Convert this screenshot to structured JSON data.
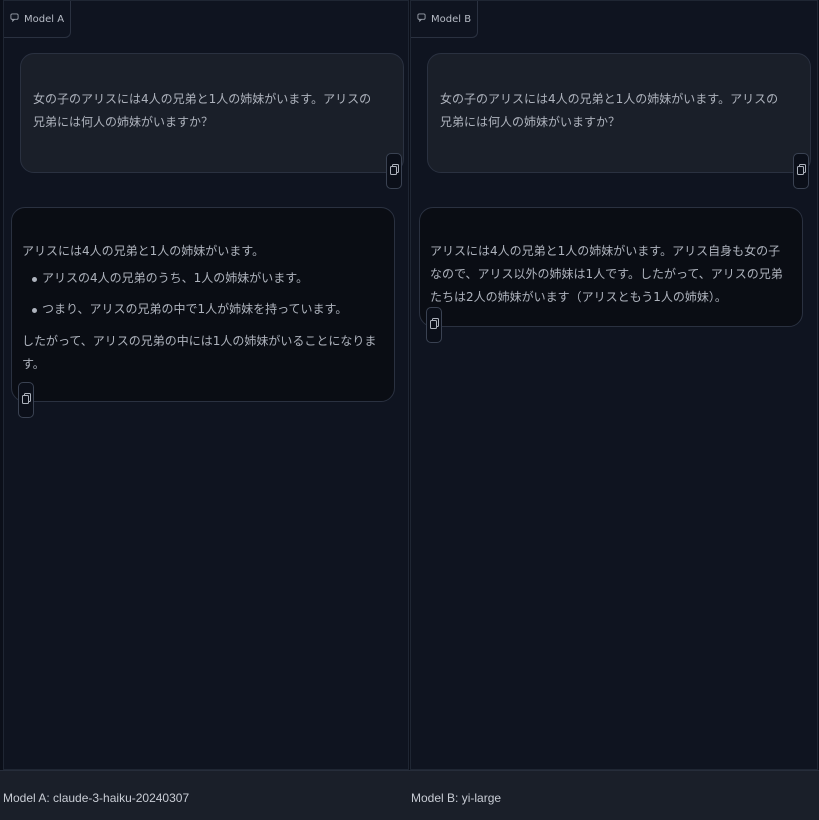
{
  "panel_a": {
    "tag": "Model A",
    "user_message": "女の子のアリスには4人の兄弟と1人の姉妹がいます。アリスの兄弟には何人の姉妹がいますか？",
    "response": {
      "intro": "アリスには4人の兄弟と1人の姉妹がいます。",
      "points": [
        "アリスの4人の兄弟のうち、1人の姉妹がいます。",
        "つまり、アリスの兄弟の中で1人が姉妹を持っています。"
      ],
      "conclusion": "したがって、アリスの兄弟の中には1人の姉妹がいることになります。"
    }
  },
  "panel_b": {
    "tag": "Model B",
    "user_message": "女の子のアリスには4人の兄弟と1人の姉妹がいます。アリスの兄弟には何人の姉妹がいますか？",
    "response": "アリスには4人の兄弟と1人の姉妹がいます。アリス自身も女の子なので、アリス以外の姉妹は1人です。したがって、アリスの兄弟たちは2人の姉妹がいます（アリスともう1人の姉妹）。"
  },
  "footer": {
    "model_a_label": "Model A: claude-3-haiku-20240307",
    "model_b_label": "Model B: yi-large"
  },
  "icons": {
    "panel_tag": "chat-bubble-icon",
    "copy": "copy-icon"
  },
  "colors": {
    "background": "#0b0f19",
    "user_bubble": "#1a1f29",
    "bot_bubble": "#0a0d14",
    "border": "#2a3140",
    "text": "#aeb3bd"
  }
}
